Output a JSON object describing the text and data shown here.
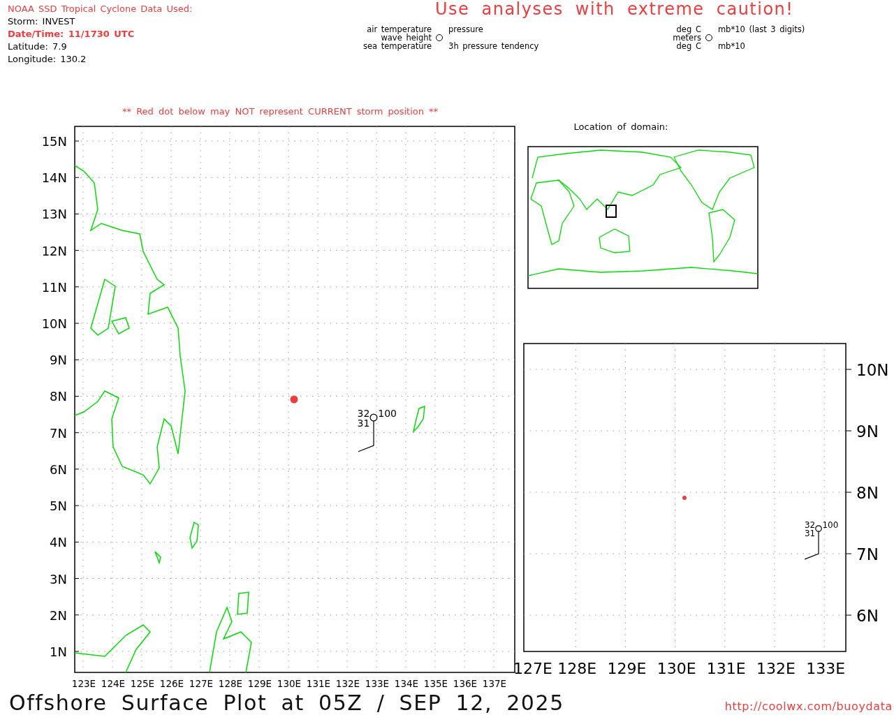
{
  "header": {
    "source": "NOAA SSD Tropical Cyclone Data Used:",
    "storm": "Storm: INVEST",
    "datetime": "Date/Time: 11/1730 UTC",
    "latitude": "Latitude: 7.9",
    "longitude": "Longitude: 130.2"
  },
  "caution": "Use analyses with extreme caution!",
  "legends": [
    {
      "rows": [
        {
          "left": "air temperature",
          "right": "pressure"
        },
        {
          "left": "wave height"
        },
        {
          "left": "sea temperature",
          "right": "3h pressure tendency"
        }
      ]
    },
    {
      "rows": [
        {
          "left": "deg C",
          "right": "mb*10 (last 3 digits)"
        },
        {
          "left": "meters"
        },
        {
          "left": "deg C",
          "right": "mb*10"
        }
      ]
    }
  ],
  "note": "** Red dot below may NOT represent CURRENT storm position **",
  "main_map": {
    "lat_labels": [
      "15N",
      "14N",
      "13N",
      "12N",
      "11N",
      "10N",
      "9N",
      "8N",
      "7N",
      "6N",
      "5N",
      "4N",
      "3N",
      "2N",
      "1N"
    ],
    "lon_labels": [
      "123E",
      "124E",
      "125E",
      "126E",
      "127E",
      "128E",
      "129E",
      "130E",
      "131E",
      "132E",
      "133E",
      "134E",
      "135E",
      "136E",
      "137E"
    ],
    "station": {
      "air_temp": "32",
      "sea_temp": "31",
      "pressure": "100"
    }
  },
  "domain_map": {
    "title": "Location of domain:"
  },
  "zoom_map": {
    "lat_labels": [
      "10N",
      "9N",
      "8N",
      "7N",
      "6N"
    ],
    "lon_labels": [
      "127E",
      "128E",
      "129E",
      "130E",
      "131E",
      "132E",
      "133E"
    ],
    "station": {
      "air_temp": "32",
      "sea_temp": "31",
      "pressure": "100"
    }
  },
  "footer": {
    "title": "Offshore Surface Plot at 05Z / SEP 12, 2025",
    "url": "http://coolwx.com/buoydata"
  }
}
